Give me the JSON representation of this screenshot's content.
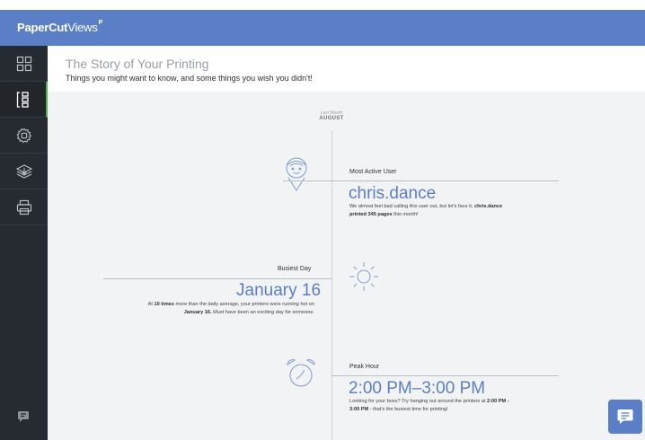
{
  "header": {
    "brand_bold": "PaperCut",
    "brand_light": "Views",
    "brand_sup": "P"
  },
  "page": {
    "title": "The Story of Your Printing",
    "subtitle": "Things you might want to know, and some things you wish you didn't!"
  },
  "sidebar": {
    "items": [
      {
        "icon": "dashboard-icon"
      },
      {
        "icon": "insights-icon",
        "active": true
      },
      {
        "icon": "settings-icon"
      },
      {
        "icon": "layers-icon"
      },
      {
        "icon": "printer-icon"
      }
    ],
    "footer_icon": "chat-bubble-icon"
  },
  "timeline": {
    "period_small": "Last Month",
    "period_month": "AUGUST",
    "events": [
      {
        "label": "Most Active User",
        "value": "chris.dance",
        "desc_1": "We almost feel bad calling this user out, but let's face it, ",
        "desc_user": "chris.dance",
        "desc_2": "printed 345 pages",
        "desc_3": " this month!"
      },
      {
        "label": "Busiest Day",
        "value": "January 16",
        "desc_1": "At ",
        "desc_times": "10 times",
        "desc_2": " more than the daily average, your printers were running hot on",
        "desc_date": "January 16.",
        "desc_3": " Must have been an exciting day for someone."
      },
      {
        "label": "Peak Hour",
        "value": "2:00 PM–3:00 PM",
        "desc_1": "Looking for your boss? Try hanging out around the printers at ",
        "desc_range": "2:00 PM -",
        "desc_range2": "3:00 PM",
        "desc_2": " - that's the busiest time for printing!"
      }
    ]
  },
  "colors": {
    "topbar": "#5b7fc6",
    "sidebar": "#262b31",
    "accent": "#5a7fc4",
    "active_indicator": "#4caf50"
  },
  "help_button": {
    "icon": "chat-icon"
  }
}
